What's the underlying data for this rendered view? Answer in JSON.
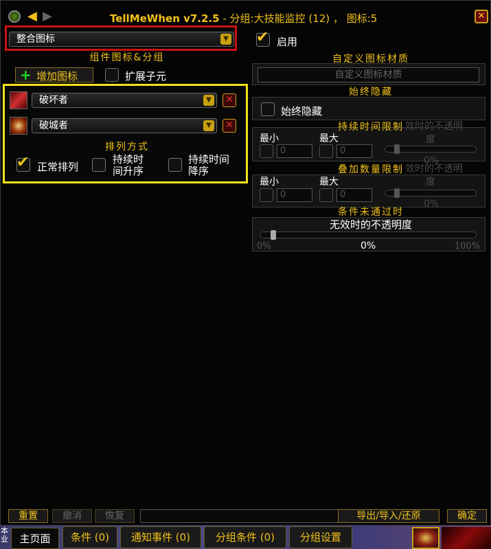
{
  "window": {
    "title_prefix": "TellMeWhen v7.2.5",
    "title_suffix": " - 分组:大技能监控 (12) ， 图标:5"
  },
  "left": {
    "type_dropdown": "整合图标",
    "components_header": "组件图标&分组",
    "add_icon_label": "增加图标",
    "expand_children_label": "扩展子元",
    "components": [
      {
        "name": "破坏者"
      },
      {
        "name": "破城者"
      }
    ],
    "sort_header": "排列方式",
    "sort_options": {
      "normal": "正常排列",
      "asc_line1": "持续时",
      "asc_line2": "间升序",
      "desc_line1": "持续时间",
      "desc_line2": "降序"
    }
  },
  "right": {
    "enable_label": "启用",
    "custom_tex_header": "自定义图标材质",
    "custom_tex_placeholder": "自定义图标材质",
    "always_hide_header": "始终隐藏",
    "always_hide_label": "始终隐藏",
    "duration_header": "持续时间限制",
    "duration_overlay": "效时的不透明",
    "duration_overlay2": "度",
    "min_label": "最小",
    "max_label": "最大",
    "min_value": "0",
    "max_value": "0",
    "duration_pct": "0%",
    "stack_header": "叠加数量限制",
    "stack_overlay": "效时的不透明",
    "stack_overlay2": "度",
    "stack_pct": "0%",
    "cond_header": "条件未通过时",
    "invalid_alpha_label": "无效时的不透明度",
    "slider_min": "0%",
    "slider_max": "100%",
    "slider_value": "0%"
  },
  "bottom": {
    "reset": "重置",
    "undo": "撤消",
    "redo": "恢复",
    "import_export": "导出/导入/还原",
    "ok": "确定"
  },
  "tabs": {
    "main": "主页面",
    "conditions": "条件 (0)",
    "notifications": "通知事件 (0)",
    "group_conditions": "分组条件 (0)",
    "group_settings": "分组设置"
  },
  "game_ui": {
    "left_text1": "本",
    "left_text2": "业"
  },
  "colors": {
    "accent_gold": "#f2c21a",
    "highlight_red": "#cc1111",
    "highlight_yellow": "#f2e21a"
  }
}
